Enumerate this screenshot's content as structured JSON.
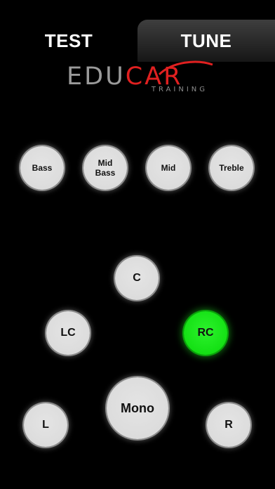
{
  "tabs": {
    "test": "TEST",
    "tune": "TUNE",
    "active": "tune"
  },
  "logo": {
    "main_left": "EDU",
    "main_right": "CAR",
    "sub": "TRAINING",
    "colors": {
      "left": "#9a9a9a",
      "right": "#e02020"
    }
  },
  "bands": [
    {
      "label": "Bass"
    },
    {
      "label": "Mid Bass"
    },
    {
      "label": "Mid"
    },
    {
      "label": "Treble"
    }
  ],
  "speakers": {
    "c": "C",
    "lc": "LC",
    "rc": "RC",
    "mono": "Mono",
    "l": "L",
    "r": "R",
    "active": "rc"
  },
  "colors": {
    "background": "#000000",
    "button": "#dcdcdc",
    "active": "#14e014"
  }
}
